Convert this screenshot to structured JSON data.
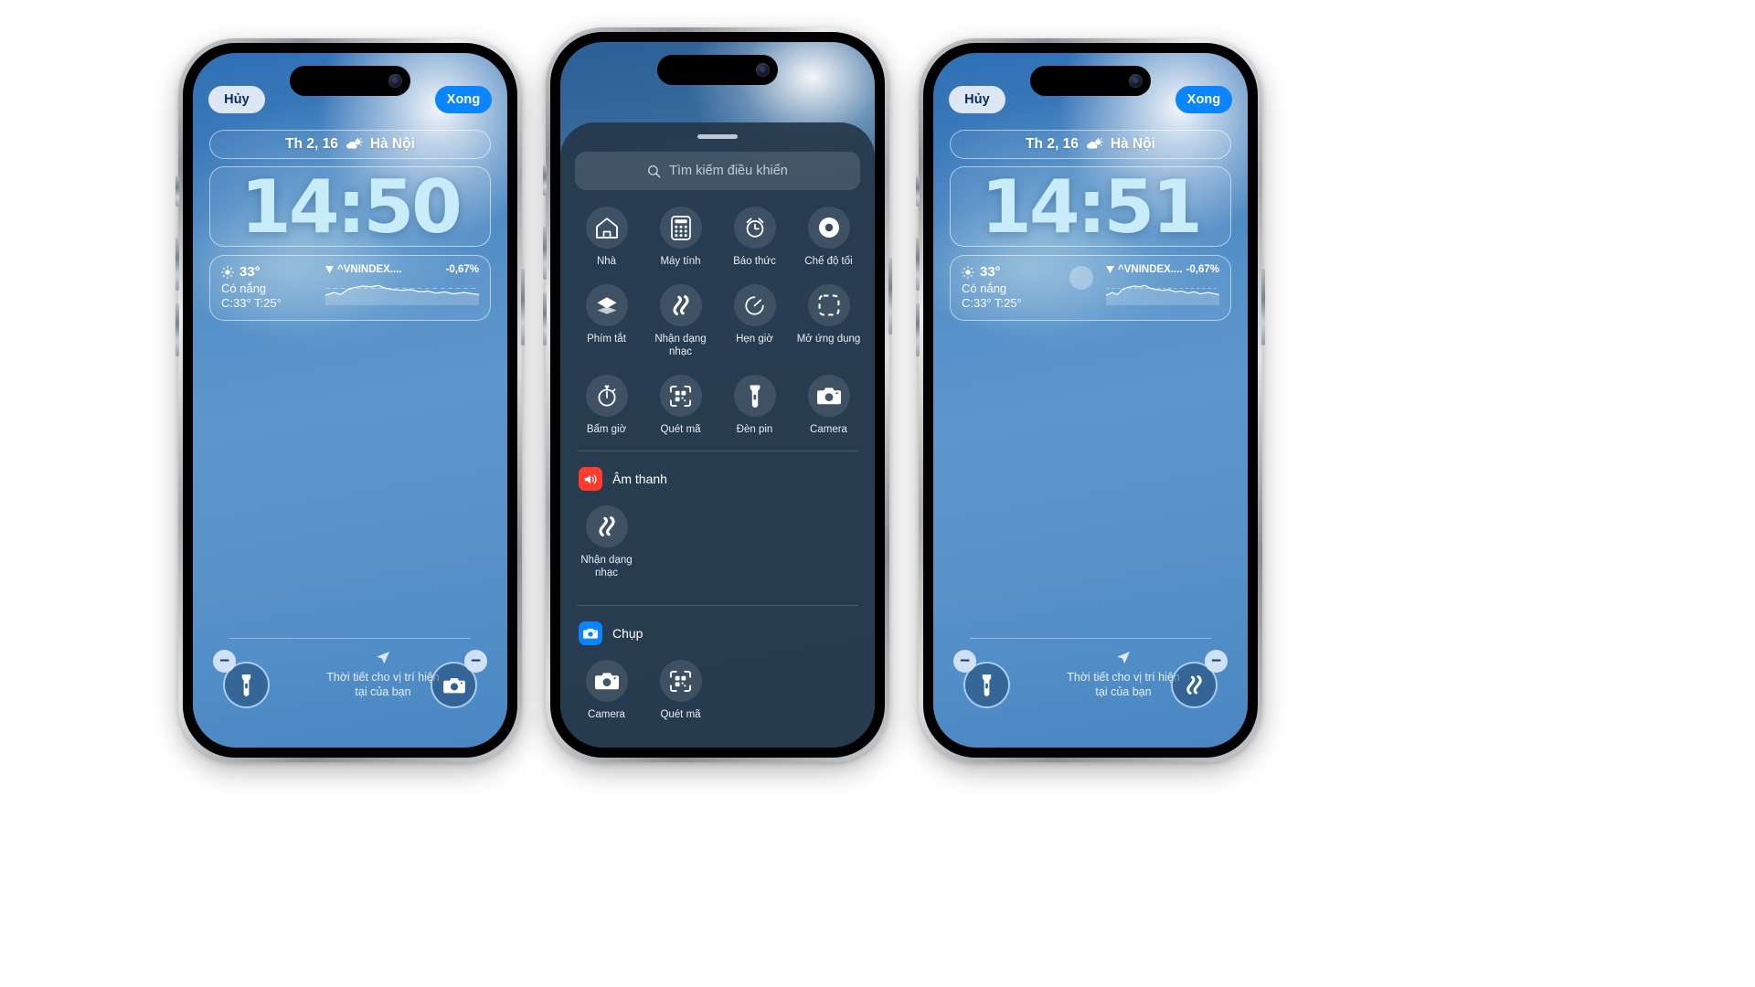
{
  "phones": {
    "left": {
      "topbar": {
        "cancel_label": "Hủy",
        "done_label": "Xong"
      },
      "date_widget": {
        "date": "Th 2, 16",
        "weather_icon": "sun-behind-cloud-icon",
        "location": "Hà Nội"
      },
      "clock": "14:50",
      "weather_widget": {
        "icon": "sun-icon",
        "temperature": "33°",
        "condition": "Có nắng",
        "range": "C:33° T:25°"
      },
      "stock_widget": {
        "direction_icon": "triangle-down-icon",
        "symbol": "^VNINDEX....",
        "change": "-0,67%"
      },
      "hint": {
        "icon": "location-arrow-icon",
        "line1": "Thời tiết cho vị trí hiện",
        "line2": "tại của bạn"
      },
      "controls": [
        {
          "name": "flashlight",
          "icon": "flashlight-icon",
          "badge": "−"
        },
        {
          "name": "camera",
          "icon": "camera-icon",
          "badge": "−"
        }
      ]
    },
    "middle": {
      "search": {
        "icon": "search-icon",
        "placeholder": "Tìm kiếm điều khiển"
      },
      "grid": [
        {
          "icon": "home-icon",
          "label": "Nhà"
        },
        {
          "icon": "calculator-icon",
          "label": "Máy tính"
        },
        {
          "icon": "alarm-clock-icon",
          "label": "Báo thức"
        },
        {
          "icon": "dark-mode-icon",
          "label": "Chế độ tối"
        },
        {
          "icon": "shortcuts-icon",
          "label": "Phím tắt"
        },
        {
          "icon": "shazam-icon",
          "label": "Nhận dạng nhạc"
        },
        {
          "icon": "timer-icon",
          "label": "Hẹn giờ"
        },
        {
          "icon": "open-app-icon",
          "label": "Mở ứng dụng"
        },
        {
          "icon": "stopwatch-icon",
          "label": "Bấm giờ"
        },
        {
          "icon": "qr-scan-icon",
          "label": "Quét mã"
        },
        {
          "icon": "flashlight-icon",
          "label": "Đèn pin"
        },
        {
          "icon": "camera-icon",
          "label": "Camera"
        }
      ],
      "sections": [
        {
          "icon": "speaker-wave-icon",
          "icon_color": "#ff3b30",
          "title": "Âm thanh",
          "items": [
            {
              "icon": "shazam-icon",
              "label": "Nhận dạng nhạc"
            }
          ]
        },
        {
          "icon": "camera-app-icon",
          "icon_color": "#0a84ff",
          "title": "Chụp",
          "items": [
            {
              "icon": "camera-icon",
              "label": "Camera"
            },
            {
              "icon": "qr-scan-icon",
              "label": "Quét mã"
            }
          ]
        }
      ]
    },
    "right": {
      "topbar": {
        "cancel_label": "Hủy",
        "done_label": "Xong"
      },
      "date_widget": {
        "date": "Th 2, 16",
        "weather_icon": "sun-behind-cloud-icon",
        "location": "Hà Nội"
      },
      "clock": "14:51",
      "weather_widget": {
        "icon": "sun-icon",
        "temperature": "33°",
        "condition": "Có nắng",
        "range": "C:33° T:25°"
      },
      "stock_widget": {
        "direction_icon": "triangle-down-icon",
        "symbol": "^VNINDEX....",
        "change": "-0,67%"
      },
      "hint": {
        "icon": "location-arrow-icon",
        "line1": "Thời tiết cho vị trí hiện",
        "line2": "tại của bạn"
      },
      "controls": [
        {
          "name": "flashlight",
          "icon": "flashlight-icon",
          "badge": "−"
        },
        {
          "name": "shazam",
          "icon": "shazam-icon",
          "badge": "−"
        }
      ]
    }
  },
  "colors": {
    "accent_blue": "#0a84ff",
    "clock_text": "#c9ecfb",
    "sheet_bg": "#26384a",
    "sound_red": "#ff3b30",
    "camera_blue": "#0a84ff"
  }
}
